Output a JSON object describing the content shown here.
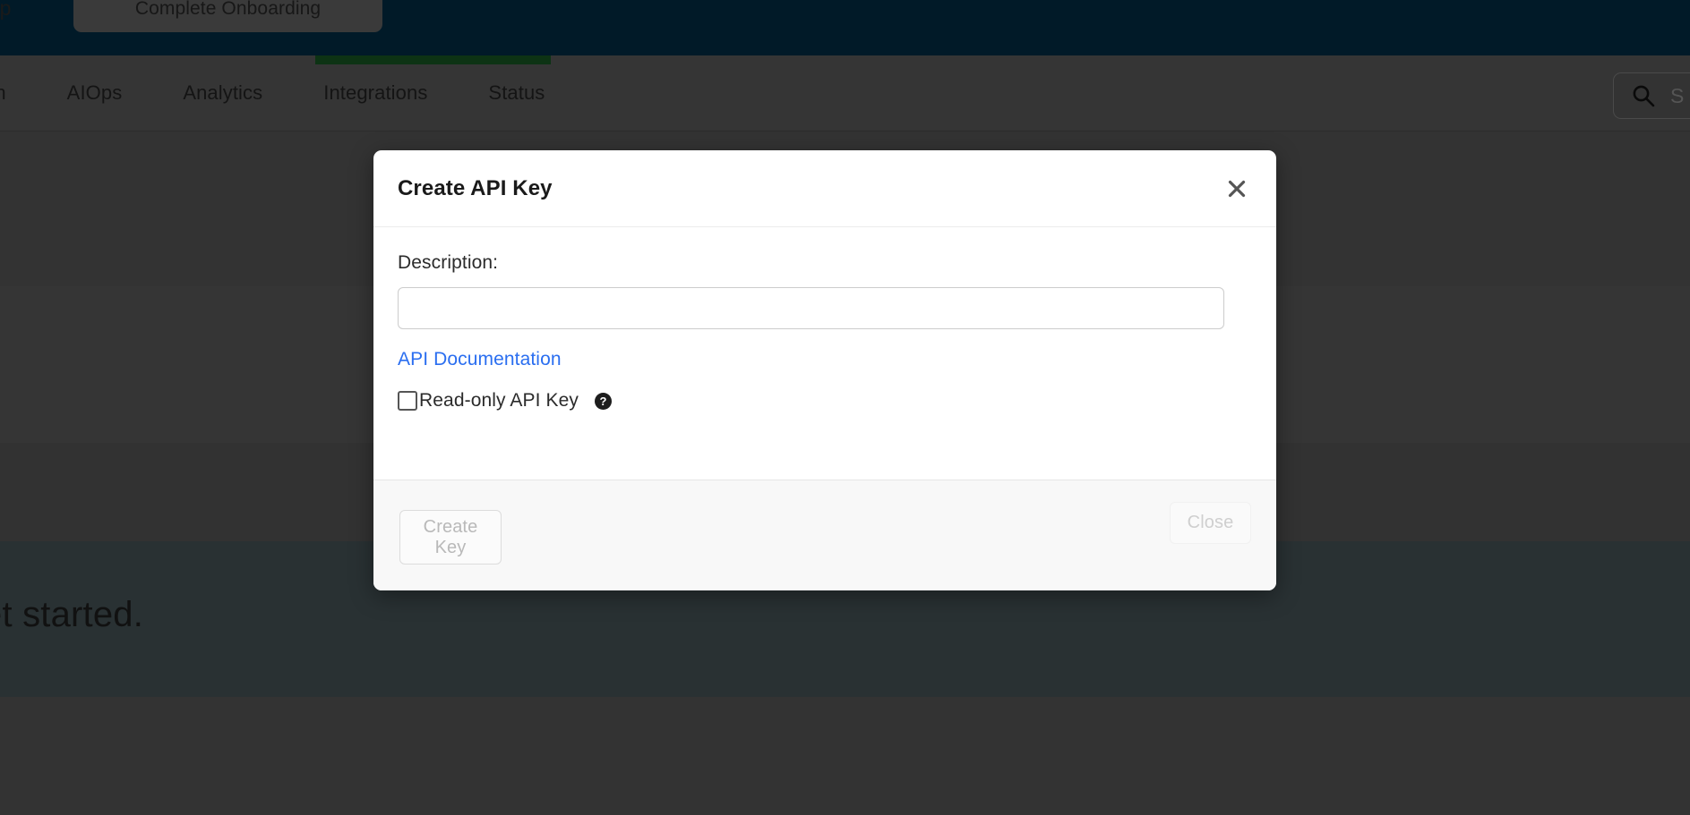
{
  "background": {
    "top_bar": {
      "clipped_left_text": "t up",
      "onboarding_button": "Complete Onboarding"
    },
    "nav": {
      "items": [
        {
          "label": "on",
          "clipped": true
        },
        {
          "label": "AIOps",
          "clipped": false
        },
        {
          "label": "Analytics",
          "clipped": false
        },
        {
          "label": "Integrations",
          "clipped": false
        },
        {
          "label": "Status",
          "clipped": false
        }
      ],
      "active_item": "Integrations",
      "search": {
        "icon": "search-icon",
        "placeholder": "S"
      }
    },
    "hero_text": "et started."
  },
  "modal": {
    "title": "Create API Key",
    "close_icon": "close-x-icon",
    "description": {
      "label": "Description:",
      "value": "",
      "placeholder": ""
    },
    "api_doc_link": "API Documentation",
    "readonly_checkbox": {
      "label": "Read-only API Key",
      "checked": false,
      "help_icon": "question-circle-icon"
    },
    "footer": {
      "create_label": "Create Key",
      "close_label": "Close"
    }
  },
  "colors": {
    "top_bar_bg": "#011a28",
    "nav_bg": "#353535",
    "active_underline": "#0d3314",
    "hero_band": "#293133",
    "modal_bg": "#ffffff",
    "link_blue": "#2a6ef0",
    "disabled_text": "#b9b9b9"
  }
}
